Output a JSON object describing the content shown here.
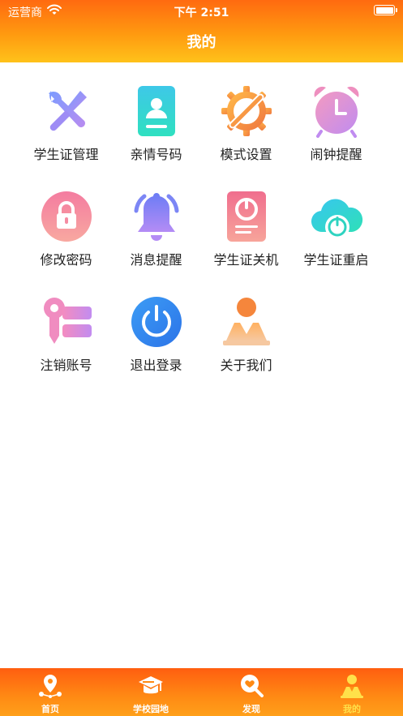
{
  "status_bar": {
    "carrier": "运营商",
    "time": "下午 2:51",
    "wifi_icon": "wifi-icon",
    "battery_icon": "battery-icon"
  },
  "header": {
    "title": "我的"
  },
  "menu": [
    {
      "label": "学生证管理",
      "icon": "tools-icon"
    },
    {
      "label": "亲情号码",
      "icon": "contact-card-icon"
    },
    {
      "label": "模式设置",
      "icon": "gear-wrench-icon"
    },
    {
      "label": "闹钟提醒",
      "icon": "alarm-clock-icon"
    },
    {
      "label": "修改密码",
      "icon": "lock-icon"
    },
    {
      "label": "消息提醒",
      "icon": "bell-icon"
    },
    {
      "label": "学生证关机",
      "icon": "device-power-icon"
    },
    {
      "label": "学生证重启",
      "icon": "cloud-power-icon"
    },
    {
      "label": "注销账号",
      "icon": "key-icon"
    },
    {
      "label": "退出登录",
      "icon": "power-icon"
    },
    {
      "label": "关于我们",
      "icon": "person-icon"
    }
  ],
  "tabbar": {
    "tabs": [
      {
        "label": "首页",
        "icon": "location-pin-icon",
        "active": false
      },
      {
        "label": "学校园地",
        "icon": "graduation-cap-icon",
        "active": false
      },
      {
        "label": "发现",
        "icon": "heart-search-icon",
        "active": false
      },
      {
        "label": "我的",
        "icon": "profile-icon",
        "active": true
      }
    ]
  },
  "colors": {
    "header_top": "#ff6a10",
    "header_bottom": "#ffc21a",
    "tabbar": "#ff8a14",
    "active_tab": "#ffe14a"
  }
}
